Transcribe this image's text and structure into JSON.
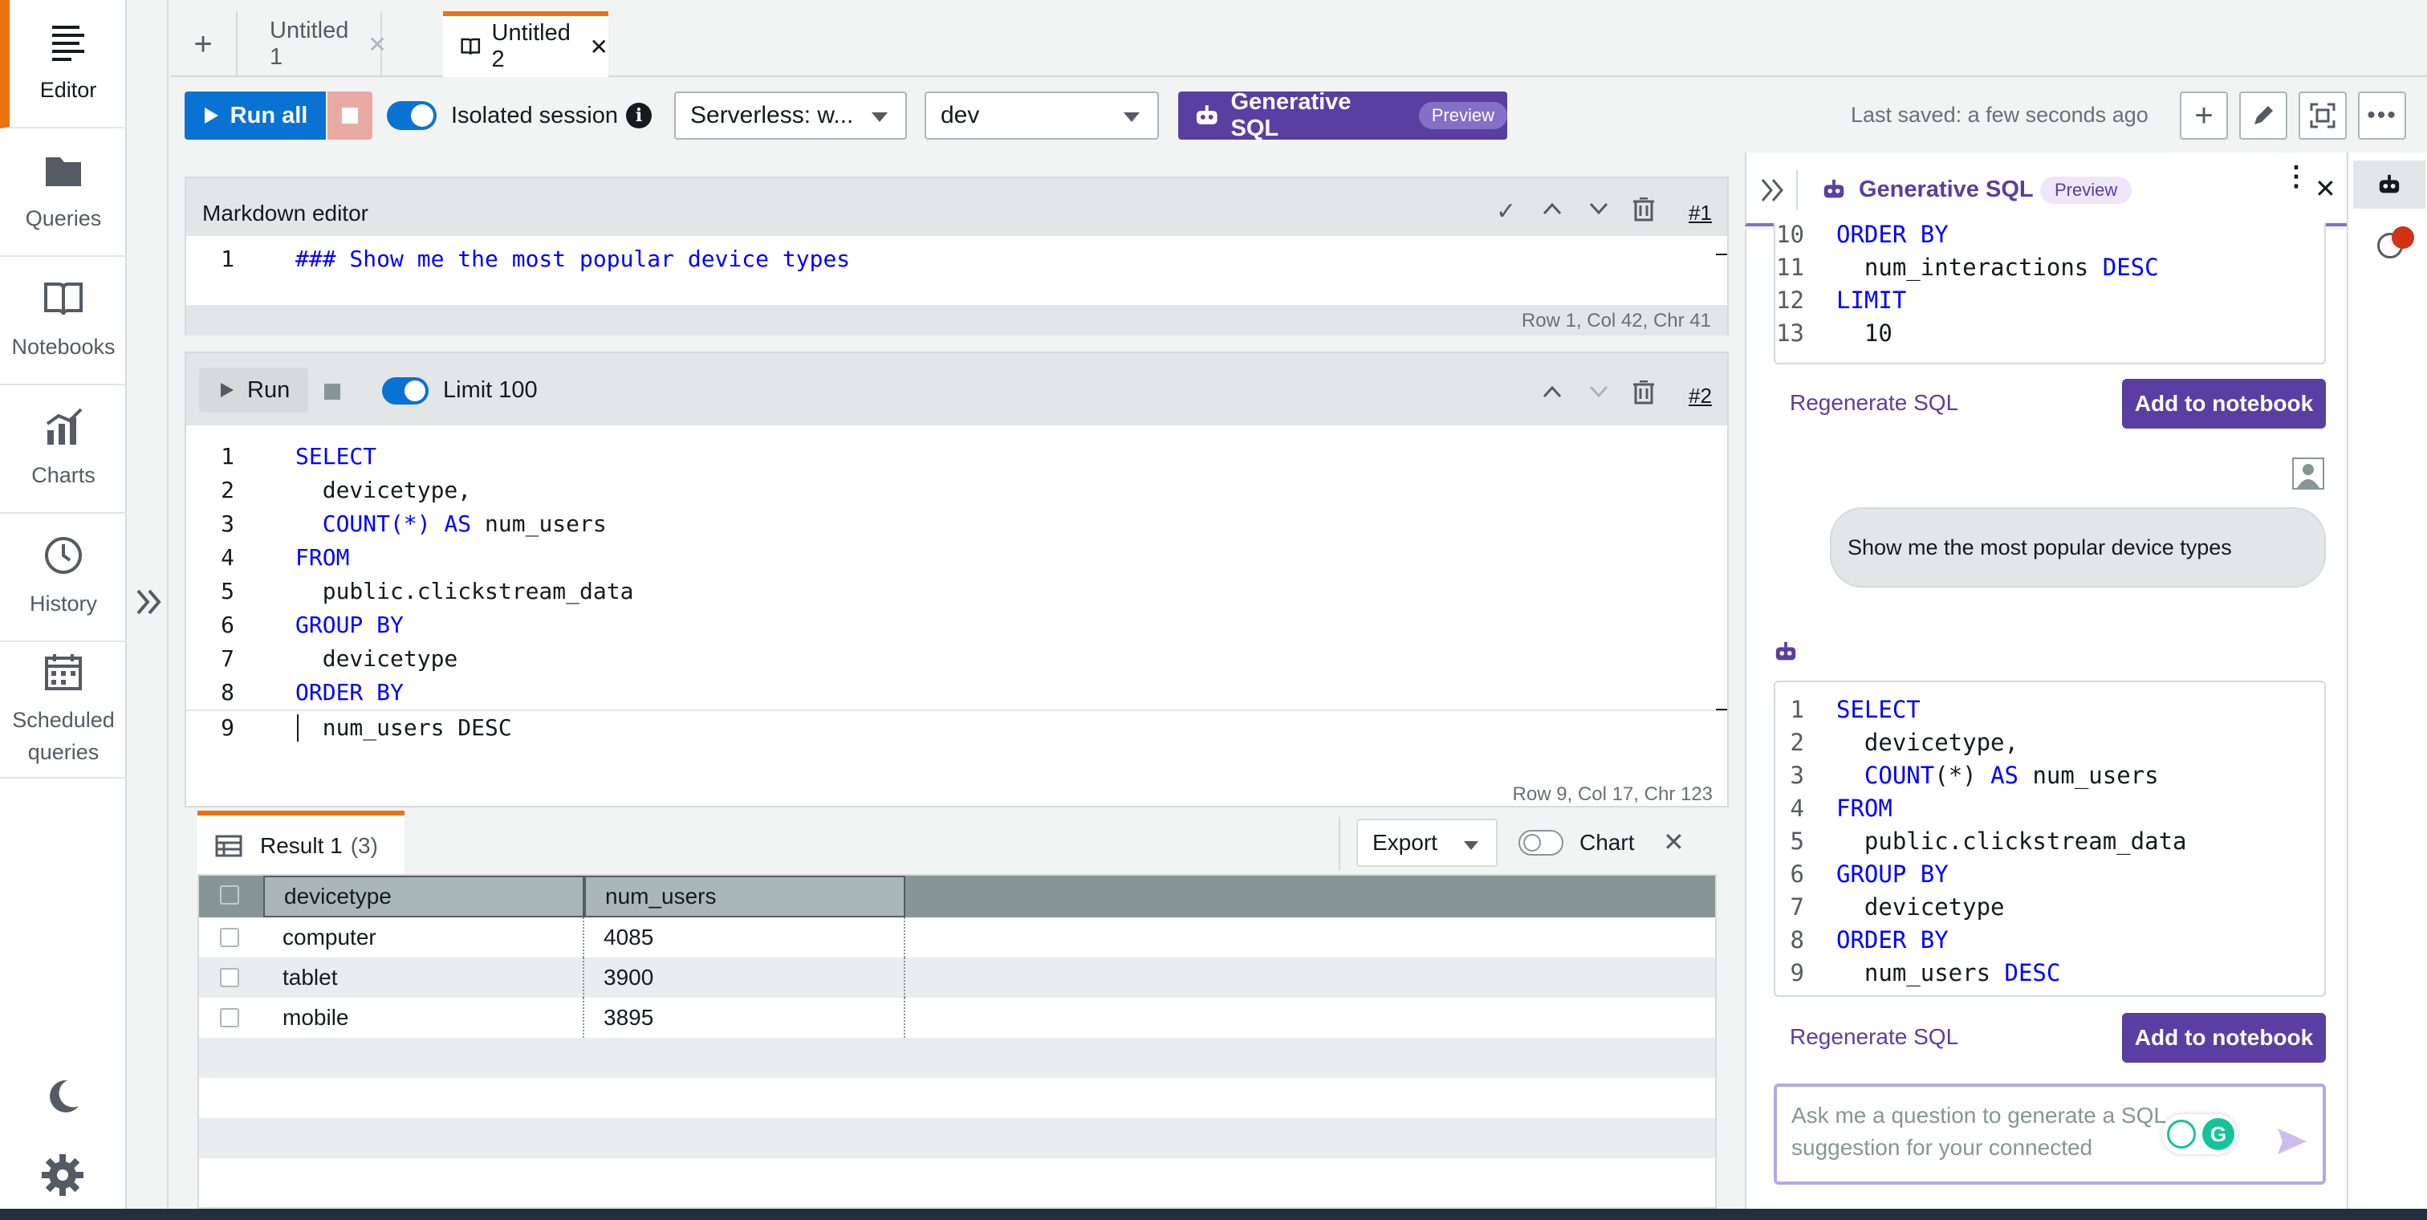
{
  "nav": {
    "items": [
      {
        "label": "Editor",
        "icon": "editor-icon"
      },
      {
        "label": "Queries",
        "icon": "folder-icon"
      },
      {
        "label": "Notebooks",
        "icon": "book-icon"
      },
      {
        "label": "Charts",
        "icon": "chart-icon"
      },
      {
        "label": "History",
        "icon": "clock-icon"
      },
      {
        "label": "Scheduled queries",
        "icon": "calendar-icon"
      }
    ]
  },
  "tabs": [
    {
      "label": "Untitled 1",
      "active": false
    },
    {
      "label": "Untitled 2",
      "active": true
    }
  ],
  "toolbar": {
    "run_all": "Run all",
    "isolated_session": "Isolated session",
    "connection": "Serverless: w...",
    "database": "dev",
    "gen_sql": "Generative SQL",
    "preview": "Preview",
    "last_saved": "Last saved: a few seconds ago"
  },
  "cell1": {
    "title": "Markdown editor",
    "index": "#1",
    "line_number": "1",
    "content": "### Show me the most popular device types",
    "status": "Row 1,  Col 42,  Chr 41"
  },
  "cell2": {
    "run": "Run",
    "limit": "Limit 100",
    "index": "#2",
    "status": "Row 9,  Col 17,  Chr 123",
    "lines": [
      {
        "n": "1",
        "kw": "SELECT",
        "rest": ""
      },
      {
        "n": "2",
        "kw": "",
        "rest": "  devicetype,"
      },
      {
        "n": "3",
        "kw": "  COUNT(*) AS",
        "rest": " num_users"
      },
      {
        "n": "4",
        "kw": "FROM",
        "rest": ""
      },
      {
        "n": "5",
        "kw": "",
        "rest": "  public.clickstream_data"
      },
      {
        "n": "6",
        "kw": "GROUP BY",
        "rest": ""
      },
      {
        "n": "7",
        "kw": "",
        "rest": "  devicetype"
      },
      {
        "n": "8",
        "kw": "ORDER BY",
        "rest": ""
      },
      {
        "n": "9",
        "kw": "",
        "rest": "  num_users DESC"
      }
    ]
  },
  "result": {
    "tab_label": "Result 1",
    "count": "(3)",
    "export": "Export",
    "chart": "Chart",
    "columns": [
      "devicetype",
      "num_users"
    ],
    "rows": [
      [
        "computer",
        "4085"
      ],
      [
        "tablet",
        "3900"
      ],
      [
        "mobile",
        "3895"
      ]
    ]
  },
  "panel": {
    "title": "Generative SQL",
    "preview": "Preview",
    "top_code": [
      {
        "n": "10",
        "text": "ORDER BY"
      },
      {
        "n": "11",
        "text": "  num_interactions DESC"
      },
      {
        "n": "12",
        "text": "LIMIT"
      },
      {
        "n": "13",
        "text": "  10"
      }
    ],
    "regenerate": "Regenerate SQL",
    "add_to_notebook": "Add to notebook",
    "user_message": "Show me the most popular device types",
    "answer_code": [
      {
        "n": "1",
        "text": "SELECT"
      },
      {
        "n": "2",
        "text": "  devicetype,"
      },
      {
        "n": "3",
        "text": "  COUNT(*) AS num_users"
      },
      {
        "n": "4",
        "text": "FROM"
      },
      {
        "n": "5",
        "text": "  public.clickstream_data"
      },
      {
        "n": "6",
        "text": "GROUP BY"
      },
      {
        "n": "7",
        "text": "  devicetype"
      },
      {
        "n": "8",
        "text": "ORDER BY"
      },
      {
        "n": "9",
        "text": "  num_users DESC"
      }
    ],
    "input_placeholder": "Ask me a question to generate a SQL suggestion for your connected database"
  },
  "colors": {
    "accent_orange": "#ec7211",
    "primary_blue": "#0972d3",
    "genai_purple": "#5a3ea1",
    "keyword_blue": "#0000ff"
  }
}
